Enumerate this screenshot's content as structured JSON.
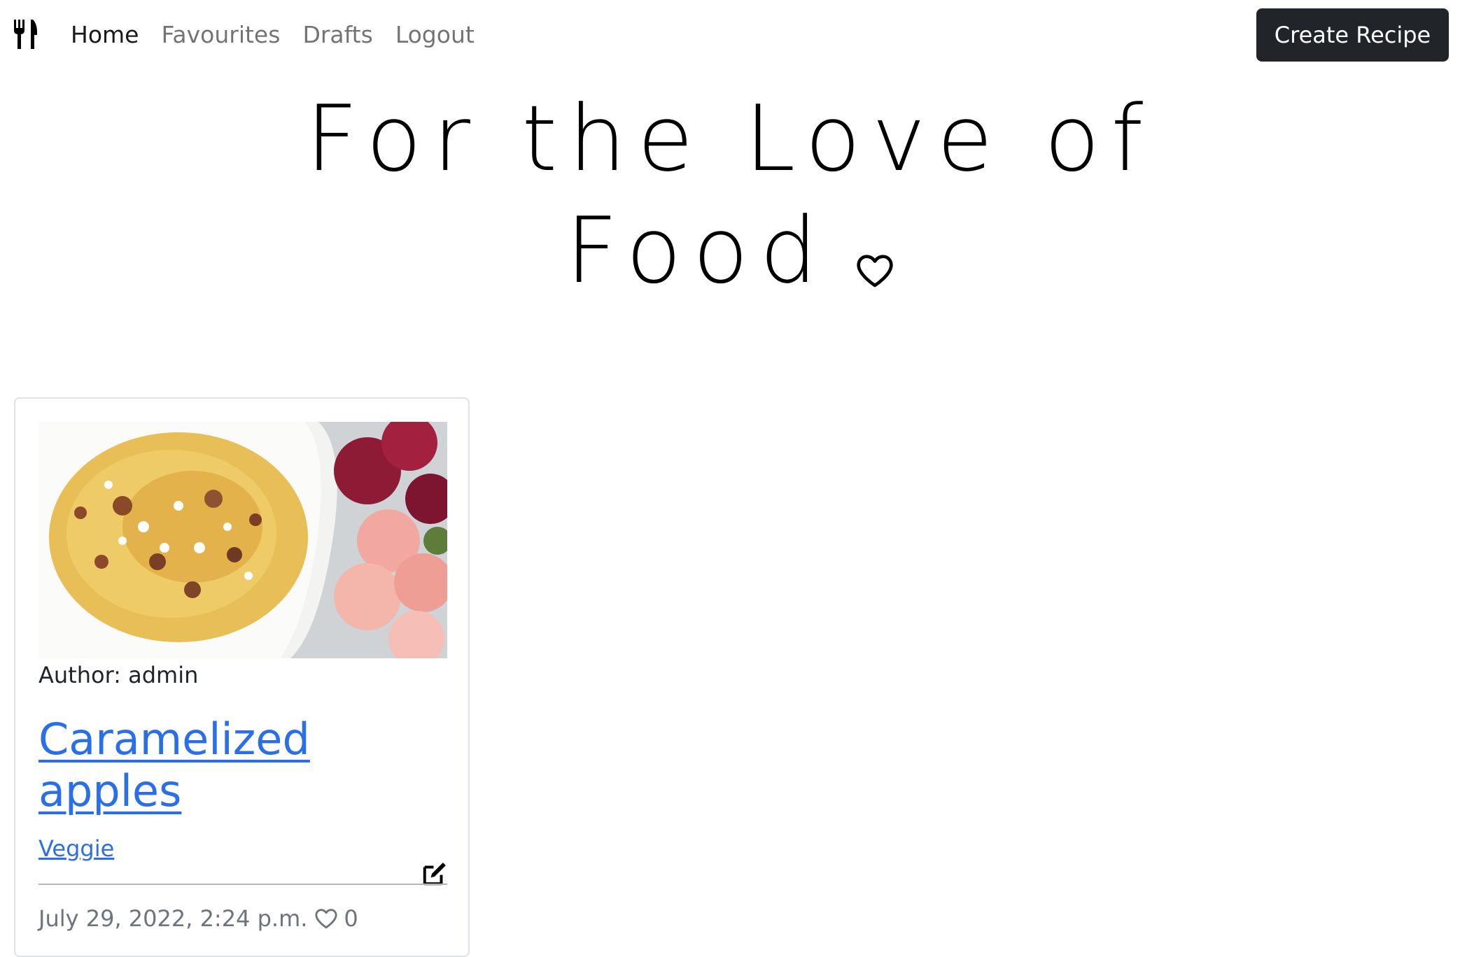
{
  "navbar": {
    "brand_icon": "utensils-icon",
    "links": [
      {
        "label": "Home",
        "active": true
      },
      {
        "label": "Favourites",
        "active": false
      },
      {
        "label": "Drafts",
        "active": false
      },
      {
        "label": "Logout",
        "active": false
      }
    ],
    "create_button_label": "Create Recipe"
  },
  "hero": {
    "line1": "For the Love of",
    "line2": "Food",
    "icon": "heart-outline-icon"
  },
  "card": {
    "image_icon": "pasta-dish-photo",
    "author_label": "Author: admin",
    "title_line1": "Caramelized",
    "title_line2": "apples",
    "category": "Veggie",
    "edit_icon": "edit-icon",
    "date": "July 29, 2022, 2:24 p.m.",
    "like_icon": "heart-outline-icon",
    "like_count": "0"
  },
  "colors": {
    "link": "#2b6fe8",
    "button_bg": "#212529",
    "muted": "#6c757d"
  }
}
